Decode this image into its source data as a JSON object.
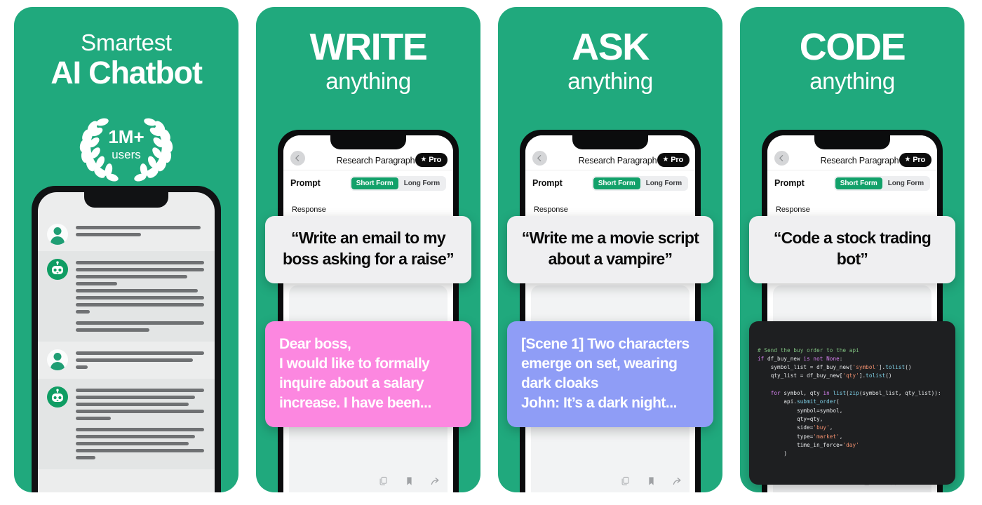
{
  "panels": [
    {
      "id": "panel-1",
      "headline_small": "Smartest",
      "headline_big": "AI Chatbot",
      "badge": {
        "number": "1M+",
        "label": "users"
      }
    },
    {
      "id": "panel-2",
      "headline_caps": "WRITE",
      "headline_sub": "anything",
      "app": {
        "title": "Research Paragraph",
        "pro_label": "Pro",
        "pro_star": "★",
        "prompt_label": "Prompt",
        "segments": [
          "Short Form",
          "Long Form"
        ],
        "selected_segment": "Short Form",
        "response_label": "Response"
      },
      "prompt_bubble": "“Write an email to my boss asking for a raise”",
      "answer_bubble": "Dear boss,\nI would like to formally inquire about a salary increase. I have been...",
      "answer_color": "#fc87e0",
      "actions": [
        "copy-icon",
        "bookmark-icon",
        "share-icon"
      ]
    },
    {
      "id": "panel-3",
      "headline_caps": "ASK",
      "headline_sub": "anything",
      "app": {
        "title": "Research Paragraph",
        "pro_label": "Pro",
        "pro_star": "★",
        "prompt_label": "Prompt",
        "segments": [
          "Short Form",
          "Long Form"
        ],
        "selected_segment": "Short Form",
        "response_label": "Response"
      },
      "prompt_bubble": "“Write me a movie script about a vampire”",
      "answer_bubble": "[Scene 1] Two characters emerge on set, wearing dark cloaks\nJohn: It’s a dark night...",
      "answer_color": "#8f9df6",
      "actions": [
        "copy-icon",
        "bookmark-icon",
        "share-icon"
      ]
    },
    {
      "id": "panel-4",
      "headline_caps": "CODE",
      "headline_sub": "anything",
      "app": {
        "title": "Research Paragraph",
        "pro_label": "Pro",
        "pro_star": "★",
        "prompt_label": "Prompt",
        "segments": [
          "Short Form",
          "Long Form"
        ],
        "selected_segment": "Short Form",
        "response_label": "Response"
      },
      "prompt_bubble": "“Code a stock trading bot”",
      "code_lines": [
        "# Send the buy order to the api",
        "if df_buy_new is not None:",
        "    symbol_list = df_buy_new['symbol'].tolist()",
        "    qty_list = df_buy_new['qty'].tolist()",
        "",
        "    for symbol, qty in list(zip(symbol_list, qty_list)):",
        "        api.submit_order(",
        "            symbol=symbol,",
        "            qty=qty,",
        "            side='buy',",
        "            type='market',",
        "            time_in_force='day'",
        "        )"
      ],
      "actions": [
        "copy-icon",
        "bookmark-icon",
        "share-icon"
      ]
    }
  ],
  "colors": {
    "brand_green": "#20a97d",
    "accent_green": "#12a16a",
    "pink": "#fc87e0",
    "blue": "#8f9df6",
    "code_bg": "#1e1f21",
    "dark": "#0b0c0d"
  }
}
